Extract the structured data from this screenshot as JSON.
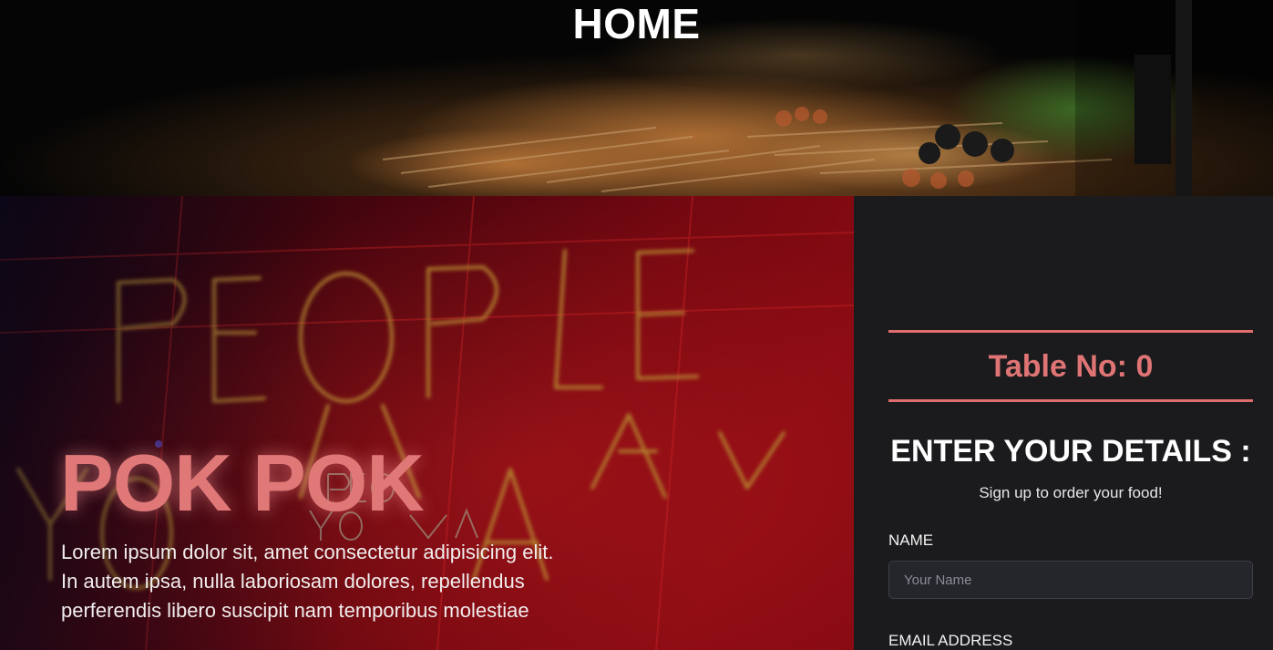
{
  "header": {
    "title": "HOME"
  },
  "hero": {
    "brand": "POK POK",
    "description_lines": [
      "Lorem ipsum dolor sit, amet consectetur adipisicing elit.",
      "In autem ipsa, nulla laboriosam dolores, repellendus",
      "perferendis libero suscipit nam temporibus molestiae"
    ],
    "neon_sign_text": "PEOPLE YOU MAY KNOW"
  },
  "panel": {
    "table_label": "Table No: 0",
    "form_title": "ENTER YOUR DETAILS :",
    "form_subtitle": "Sign up to order your food!",
    "name_label": "NAME",
    "name_placeholder": "Your Name",
    "name_value": "",
    "email_label": "EMAIL ADDRESS"
  },
  "colors": {
    "accent": "#df6e6e",
    "panel_bg": "#1b1b1e",
    "input_bg": "#25262b"
  }
}
